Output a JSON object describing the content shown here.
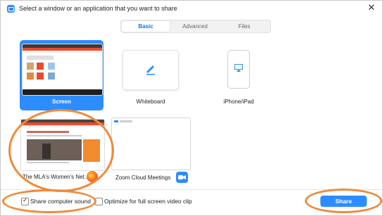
{
  "window": {
    "title": "Select a window or an application that you want to share",
    "close_glyph": "✕"
  },
  "tabs": [
    {
      "label": "Basic",
      "active": true
    },
    {
      "label": "Advanced",
      "active": false
    },
    {
      "label": "Files",
      "active": false
    }
  ],
  "tiles": {
    "screen": {
      "label": "Screen",
      "selected": true
    },
    "whiteboard": {
      "label": "Whiteboard",
      "icon": "pen-icon"
    },
    "iphone": {
      "label": "iPhone/iPad",
      "icon": "airplay-icon"
    },
    "mla_window": {
      "label": "The MLA's Women's Net...",
      "app_icon": "firefox-icon"
    },
    "zoom_window": {
      "label": "Zoom Cloud Meetings",
      "app_icon": "zoom-icon"
    }
  },
  "footer": {
    "share_sound": {
      "label": "Share computer sound",
      "checked": true
    },
    "optimize_video": {
      "label": "Optimize for full screen video clip",
      "checked": false
    },
    "share_button": "Share"
  },
  "colors": {
    "accent": "#2d8cff",
    "annotation": "#f08a3a"
  }
}
